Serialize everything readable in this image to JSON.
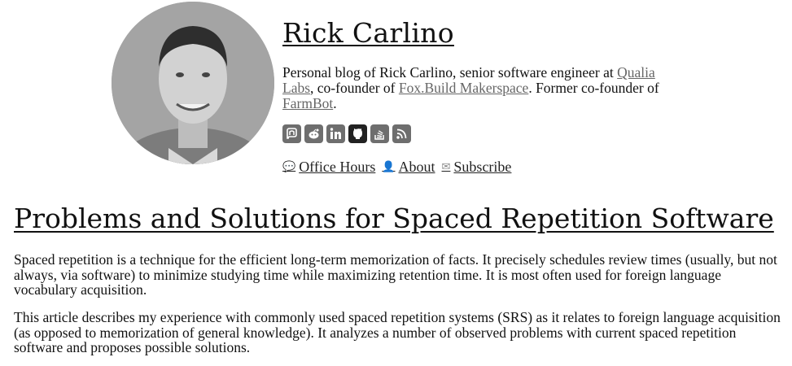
{
  "header": {
    "site_title": "Rick Carlino",
    "tagline": {
      "text1": "Personal blog of Rick Carlino, senior software engineer at ",
      "link1": "Qualia Labs",
      "text2": ", co-founder of ",
      "link2": "Fox.Build Makerspace",
      "text3": ". Former co-founder of ",
      "link3": "FarmBot",
      "text4": "."
    },
    "socials": [
      {
        "icon": "mastodon-icon"
      },
      {
        "icon": "reddit-icon"
      },
      {
        "icon": "linkedin-icon"
      },
      {
        "icon": "github-icon"
      },
      {
        "icon": "stackoverflow-icon"
      },
      {
        "icon": "rss-icon"
      }
    ],
    "nav": [
      {
        "icon": "chat-bubble-icon",
        "label": "Office Hours"
      },
      {
        "icon": "person-icon",
        "label": "About"
      },
      {
        "icon": "envelope-icon",
        "label": "Subscribe"
      }
    ]
  },
  "article": {
    "title": "Problems and Solutions for Spaced Repetition Software",
    "paragraphs": [
      "Spaced repetition is a technique for the efficient long-term memorization of facts. It precisely schedules review times (usually, but not always, via software) to minimize studying time while maximizing retention time. It is most often used for foreign language vocabulary acquisition.",
      "This article describes my experience with commonly used spaced repetition systems (SRS) as it relates to foreign language acquisition (as opposed to memorization of general knowledge). It analyzes a number of observed problems with current spaced repetition software and proposes possible solutions."
    ]
  }
}
